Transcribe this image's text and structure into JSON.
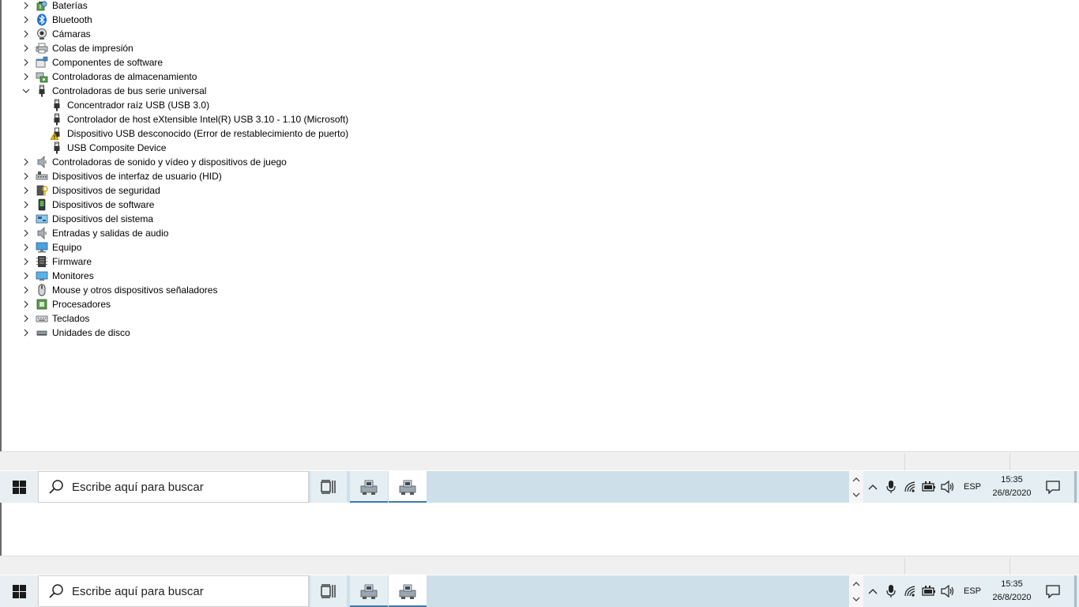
{
  "tree": {
    "items": [
      {
        "label": "Baterías",
        "icon": "battery-icon",
        "level": 0,
        "expanded": false
      },
      {
        "label": "Bluetooth",
        "icon": "bluetooth-icon",
        "level": 0,
        "expanded": false
      },
      {
        "label": "Cámaras",
        "icon": "camera-icon",
        "level": 0,
        "expanded": false
      },
      {
        "label": "Colas de impresión",
        "icon": "printer-icon",
        "level": 0,
        "expanded": false
      },
      {
        "label": "Componentes de software",
        "icon": "software-component-icon",
        "level": 0,
        "expanded": false
      },
      {
        "label": "Controladoras de almacenamiento",
        "icon": "storage-controller-icon",
        "level": 0,
        "expanded": false
      },
      {
        "label": "Controladoras de bus serie universal",
        "icon": "usb-plug-icon",
        "level": 0,
        "expanded": true
      },
      {
        "label": "Concentrador raíz USB (USB 3.0)",
        "icon": "usb-plug-icon",
        "level": 1
      },
      {
        "label": "Controlador de host eXtensible Intel(R) USB 3.10 - 1.10 (Microsoft)",
        "icon": "usb-plug-icon",
        "level": 1
      },
      {
        "label": "Dispositivo USB desconocido (Error de restablecimiento de puerto)",
        "icon": "usb-warning-icon",
        "level": 1
      },
      {
        "label": "USB Composite Device",
        "icon": "usb-plug-icon",
        "level": 1
      },
      {
        "label": "Controladoras de sonido y vídeo y dispositivos de juego",
        "icon": "speaker-icon",
        "level": 0,
        "expanded": false
      },
      {
        "label": "Dispositivos de interfaz de usuario (HID)",
        "icon": "hid-icon",
        "level": 0,
        "expanded": false
      },
      {
        "label": "Dispositivos de seguridad",
        "icon": "security-device-icon",
        "level": 0,
        "expanded": false
      },
      {
        "label": "Dispositivos de software",
        "icon": "software-device-icon",
        "level": 0,
        "expanded": false
      },
      {
        "label": "Dispositivos del sistema",
        "icon": "system-device-icon",
        "level": 0,
        "expanded": false
      },
      {
        "label": "Entradas y salidas de audio",
        "icon": "speaker-icon",
        "level": 0,
        "expanded": false
      },
      {
        "label": "Equipo",
        "icon": "computer-icon",
        "level": 0,
        "expanded": false
      },
      {
        "label": "Firmware",
        "icon": "firmware-icon",
        "level": 0,
        "expanded": false
      },
      {
        "label": "Monitores",
        "icon": "monitor-icon",
        "level": 0,
        "expanded": false
      },
      {
        "label": "Mouse y otros dispositivos señaladores",
        "icon": "mouse-icon",
        "level": 0,
        "expanded": false
      },
      {
        "label": "Procesadores",
        "icon": "processor-icon",
        "level": 0,
        "expanded": false
      },
      {
        "label": "Teclados",
        "icon": "keyboard-icon",
        "level": 0,
        "expanded": false
      },
      {
        "label": "Unidades de disco",
        "icon": "disk-drive-icon",
        "level": 0,
        "expanded": false
      }
    ]
  },
  "taskbar": {
    "search_placeholder": "Escribe aquí para buscar",
    "language": "ESP",
    "time": "15:35",
    "date": "26/8/2020"
  },
  "colors": {
    "taskbar": "#cde0ea",
    "active_underline": "#3e78b0",
    "warning": "#f2c200"
  }
}
